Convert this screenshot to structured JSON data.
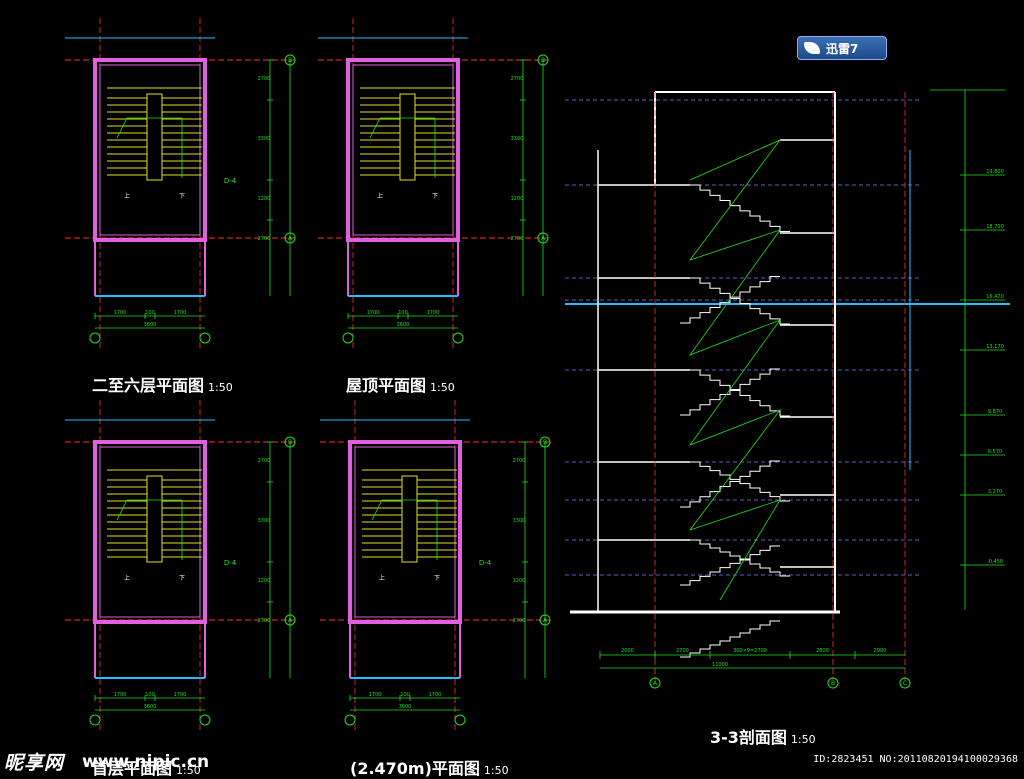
{
  "titles": {
    "plan_2_6": "二至六层平面图",
    "plan_roof": "屋顶平面图",
    "plan_1": "首层平面图",
    "plan_2470": "(2.470m)平面图",
    "section": "3-3剖面图",
    "scale": "1:50"
  },
  "badge": {
    "label": "迅雷7",
    "icon": "thunder-bird-icon"
  },
  "watermark": {
    "site": "昵享网",
    "url": "www.nipic.cn",
    "id": "ID:2823451 NO:20110820194100029368"
  },
  "grid_labels": {
    "A": "A",
    "B": "B",
    "C": "C"
  },
  "plan_dims": {
    "bottom": [
      "1700",
      "100",
      "1700"
    ],
    "total": "3600",
    "right": [
      "2700",
      "3300",
      "1200",
      "2700"
    ]
  },
  "plan_labels": {
    "up": "上",
    "down": "下",
    "door": "D-4"
  },
  "section_dims": {
    "bottom": [
      "2000",
      "2700",
      "300×9=2700",
      "2800",
      "2900"
    ],
    "total": "11000",
    "right_levels": [
      "19.800",
      "18.700",
      "16.470",
      "13.170",
      "9.870",
      "6.570",
      "3.270",
      "-0.450"
    ]
  },
  "colors": {
    "wall": "#e060e0",
    "stair": "#e0e020",
    "dim": "#20e020",
    "axis": "#ff3030",
    "grid": "#20c0ff",
    "section_wall": "#ffffff"
  }
}
